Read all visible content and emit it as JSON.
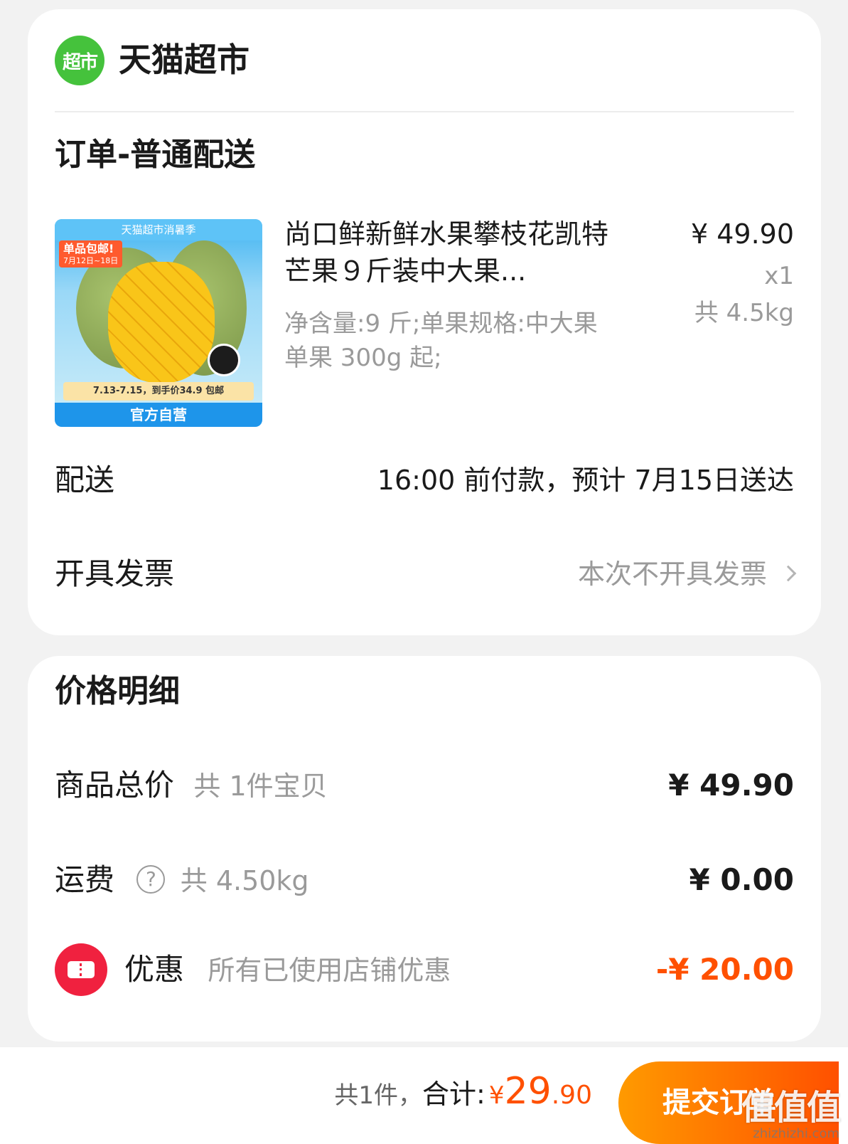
{
  "store": {
    "logo_text": "超市",
    "name": "天猫超市"
  },
  "order": {
    "section_title": "订单-普通配送",
    "product": {
      "thumb_banner": "天猫超市消暑季",
      "thumb_promo": "单品包邮!",
      "thumb_promo_date": "7月12日~18日",
      "thumb_price_note": "7.13-7.15，到手价34.9 包邮",
      "thumb_bottom": "官方自营",
      "title": "尚口鲜新鲜水果攀枝花凯特芒果９斤装中大果...",
      "spec": "净含量:9 斤;单果规格:中大果 单果 300g 起;",
      "price": "¥ 49.90",
      "qty": "x1",
      "weight": "共 4.5kg"
    },
    "delivery": {
      "label": "配送",
      "value": "16:00 前付款，预计 7月15日送达"
    },
    "invoice": {
      "label": "开具发票",
      "value": "本次不开具发票"
    }
  },
  "price_detail": {
    "section_title": "价格明细",
    "goods_total": {
      "label": "商品总价",
      "note": "共 1件宝贝",
      "amount": "¥ 49.90"
    },
    "shipping": {
      "label": "运费",
      "help": "?",
      "note": "共 4.50kg",
      "amount": "¥ 0.00"
    },
    "discount": {
      "label": "优惠",
      "note": "所有已使用店铺优惠",
      "amount": "-¥ 20.00"
    }
  },
  "footer": {
    "count": "共1件，",
    "total_label": "合计:",
    "currency": "¥",
    "total_int": "29",
    "total_dec": ".90",
    "submit_label": "提交订单"
  },
  "watermark": {
    "logo": "值值值",
    "url": "zhizhizhi.com"
  },
  "colors": {
    "accent": "#ff5000",
    "store_logo": "#45c23c",
    "coupon": "#f0213f"
  }
}
